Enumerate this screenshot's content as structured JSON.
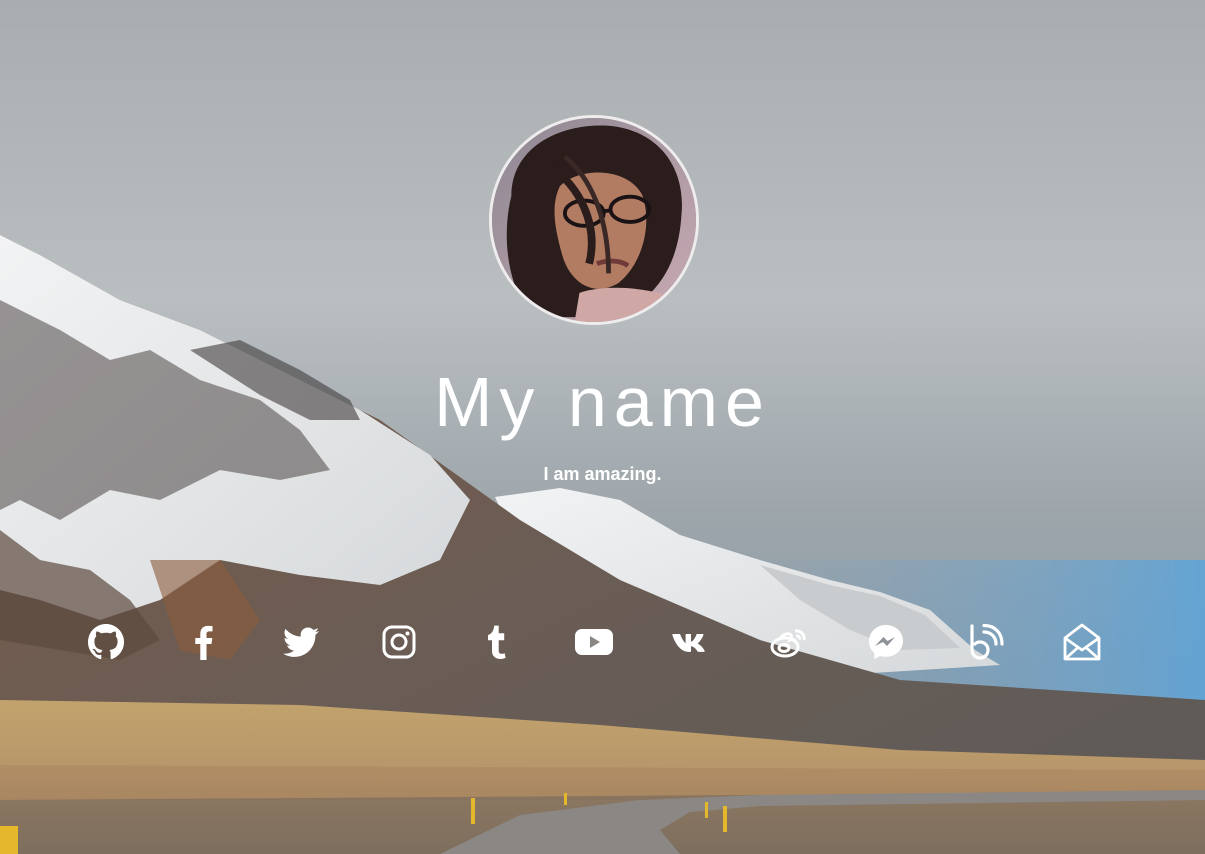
{
  "profile": {
    "name": "My name",
    "tagline": "I am amazing."
  },
  "avatar": {
    "icon": "profile-photo"
  },
  "socials": [
    {
      "icon": "github-icon"
    },
    {
      "icon": "facebook-icon"
    },
    {
      "icon": "twitter-icon"
    },
    {
      "icon": "instagram-icon"
    },
    {
      "icon": "tumblr-icon"
    },
    {
      "icon": "youtube-icon"
    },
    {
      "icon": "vk-icon"
    },
    {
      "icon": "weibo-icon"
    },
    {
      "icon": "messenger-icon"
    },
    {
      "icon": "blogger-icon"
    },
    {
      "icon": "email-icon"
    }
  ],
  "colors": {
    "text": "#ffffff",
    "sky": "#a9b0b4",
    "ground": "#c3a873"
  }
}
